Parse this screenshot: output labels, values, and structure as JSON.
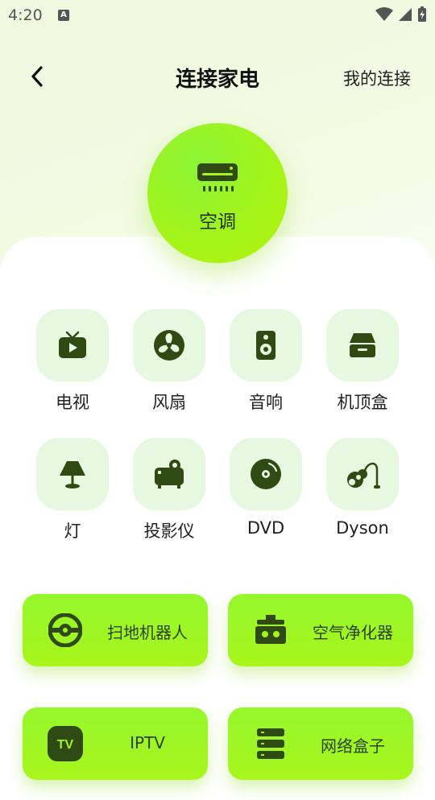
{
  "status_bar": {
    "time": "4:20",
    "a_badge": "A"
  },
  "header": {
    "title": "连接家电",
    "right_link": "我的连接"
  },
  "hero": {
    "label": "空调",
    "icon": "air-conditioner-icon"
  },
  "devices": [
    {
      "label": "电视",
      "icon": "tv-icon"
    },
    {
      "label": "风扇",
      "icon": "fan-icon"
    },
    {
      "label": "音响",
      "icon": "speaker-icon"
    },
    {
      "label": "机顶盒",
      "icon": "set-top-box-icon"
    },
    {
      "label": "灯",
      "icon": "lamp-icon"
    },
    {
      "label": "投影仪",
      "icon": "projector-icon"
    },
    {
      "label": "DVD",
      "icon": "dvd-icon"
    },
    {
      "label": "Dyson",
      "icon": "vacuum-icon"
    }
  ],
  "big_buttons": [
    {
      "label": "扫地机器人",
      "icon": "robot-vacuum-icon"
    },
    {
      "label": "空气净化器",
      "icon": "air-purifier-icon"
    },
    {
      "label": "IPTV",
      "icon": "iptv-icon",
      "icon_text": "TV"
    },
    {
      "label": "网络盒子",
      "icon": "network-box-icon"
    }
  ],
  "colors": {
    "accent": "#a3f41a",
    "icon_dark": "#2f4a12",
    "tile_bg": "#e6f8df"
  }
}
